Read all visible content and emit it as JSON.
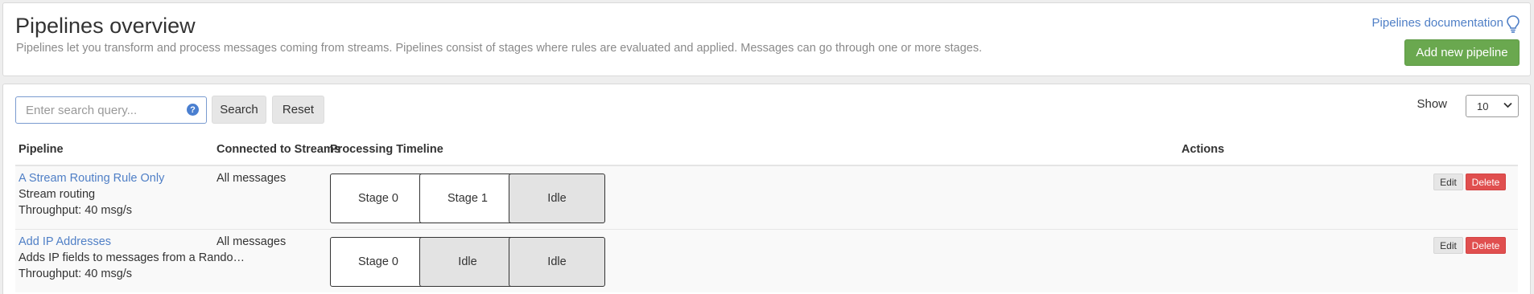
{
  "header": {
    "title": "Pipelines overview",
    "description": "Pipelines let you transform and process messages coming from streams. Pipelines consist of stages where rules are evaluated and applied. Messages can go through one or more stages.",
    "doc_link": "Pipelines documentation",
    "add_button": "Add new pipeline"
  },
  "toolbar": {
    "search_placeholder": "Enter search query...",
    "search_value": "",
    "help_icon": "?",
    "search_button": "Search",
    "reset_button": "Reset",
    "show_label": "Show",
    "page_size": "10"
  },
  "table": {
    "columns": [
      "Pipeline",
      "Connected to Streams",
      "Processing Timeline",
      "Actions"
    ],
    "rows": [
      {
        "title": "A Stream Routing Rule Only",
        "description": "Stream routing",
        "throughput": "Throughput: 40 msg/s",
        "streams": "All messages",
        "stages": [
          {
            "label": "Stage 0",
            "idle": false
          },
          {
            "label": "Stage 1",
            "idle": false
          },
          {
            "label": "Idle",
            "idle": true
          }
        ],
        "edit": "Edit",
        "delete": "Delete"
      },
      {
        "title": "Add IP Addresses",
        "description": "Adds IP fields to messages from a Random HTTP generator input",
        "throughput": "Throughput: 40 msg/s",
        "streams": "All messages",
        "stages": [
          {
            "label": "Stage 0",
            "idle": false
          },
          {
            "label": "Idle",
            "idle": true
          },
          {
            "label": "Idle",
            "idle": true
          }
        ],
        "edit": "Edit",
        "delete": "Delete"
      }
    ]
  },
  "colors": {
    "accent_link": "#4f7fc6",
    "primary_button": "#6aa84f",
    "danger_button": "#e04f4f",
    "idle_stage": "#e3e3e3"
  }
}
